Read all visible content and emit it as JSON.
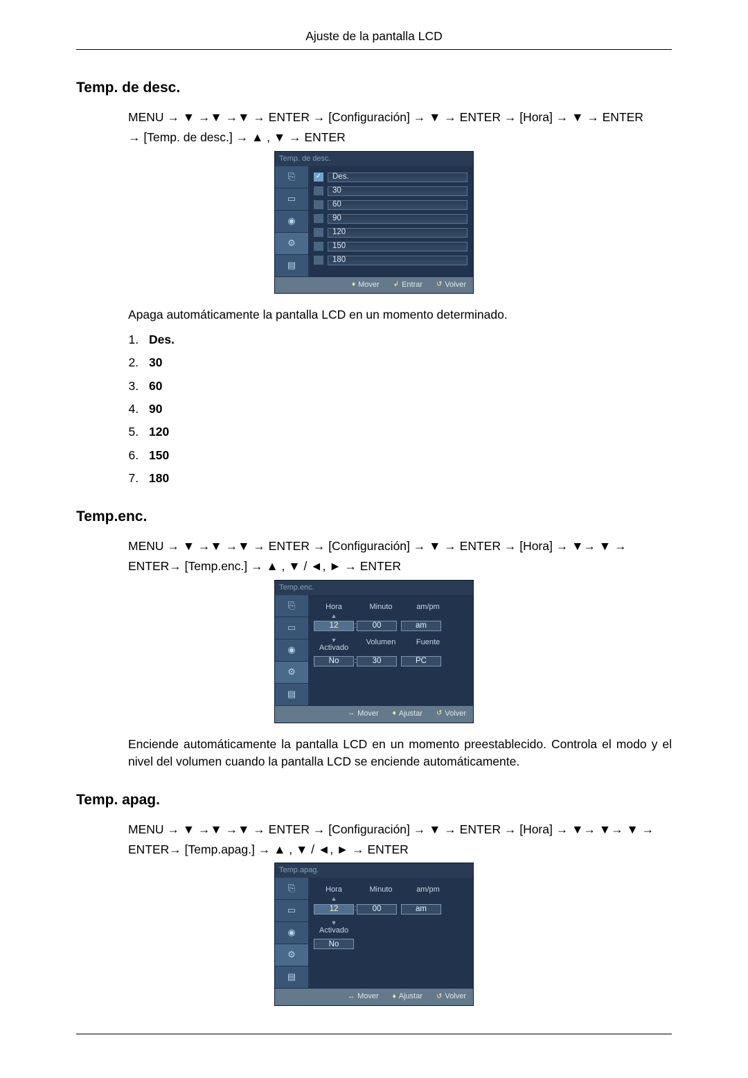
{
  "page_header": "Ajuste de la pantalla LCD",
  "sec1": {
    "title": "Temp. de desc.",
    "path_line1": "MENU → ▼ →▼ →▼ → ENTER → [Configuración] → ▼ → ENTER → [Hora] → ▼ → ENTER",
    "path_line2": "→ [Temp. de desc.] → ▲ , ▼ → ENTER",
    "osd_title": "Temp. de desc.",
    "options": [
      "Des.",
      "30",
      "60",
      "90",
      "120",
      "150",
      "180"
    ],
    "footer": {
      "move": "Mover",
      "enter": "Entrar",
      "back": "Volver"
    },
    "description": "Apaga automáticamente la pantalla LCD en un momento determinado.",
    "list": [
      "Des.",
      "30",
      "60",
      "90",
      "120",
      "150",
      "180"
    ]
  },
  "sec2": {
    "title": "Temp.enc.",
    "path_line1": "MENU → ▼ →▼ →▼ → ENTER → [Configuración] → ▼ → ENTER → [Hora] → ▼→ ▼ →",
    "path_line2": "ENTER→ [Temp.enc.] → ▲ , ▼ / ◄, ► → ENTER",
    "osd_title": "Temp.enc.",
    "row1_labels": {
      "hora": "Hora",
      "minuto": "Minuto",
      "ampm": "am/pm"
    },
    "row1_values": {
      "hora": "12",
      "minuto": "00",
      "ampm": "am"
    },
    "row2_labels": {
      "activado": "Activado",
      "volumen": "Volumen",
      "fuente": "Fuente"
    },
    "row2_values": {
      "activado": "No",
      "volumen": "30",
      "fuente": "PC"
    },
    "footer": {
      "move": "Mover",
      "adjust": "Ajustar",
      "back": "Volver"
    },
    "description": "Enciende automáticamente la pantalla LCD en un momento preestablecido. Controla el modo y el nivel del volumen cuando la pantalla LCD se enciende automáticamente."
  },
  "sec3": {
    "title": "Temp. apag.",
    "path_line1": "MENU → ▼ →▼ →▼ → ENTER → [Configuración] → ▼ → ENTER → [Hora] → ▼→ ▼→ ▼ →",
    "path_line2": "ENTER→ [Temp.apag.] → ▲ , ▼ / ◄, ► → ENTER",
    "osd_title": "Temp.apag.",
    "row1_labels": {
      "hora": "Hora",
      "minuto": "Minuto",
      "ampm": "am/pm"
    },
    "row1_values": {
      "hora": "12",
      "minuto": "00",
      "ampm": "am"
    },
    "row2_labels": {
      "activado": "Activado"
    },
    "row2_values": {
      "activado": "No"
    },
    "footer": {
      "move": "Mover",
      "adjust": "Ajustar",
      "back": "Volver"
    }
  }
}
